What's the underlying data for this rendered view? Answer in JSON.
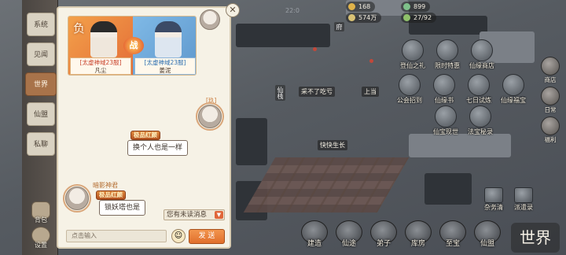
{
  "resources": [
    {
      "icon": "copper-coin-icon",
      "value": "168",
      "color": "#e0b34a"
    },
    {
      "icon": "jade-icon",
      "value": "899",
      "color": "#7ec08a"
    },
    {
      "icon": "spirit-stone-icon",
      "value": "574万",
      "color": "#d9c275"
    },
    {
      "icon": "population-icon",
      "value": "27/92",
      "color": "#8fc06a"
    }
  ],
  "map_timer": "22:0",
  "map_labels": {
    "hut": "府",
    "shop_sign": "仙栈",
    "leek": "采不了吃亏",
    "sign": "上当",
    "crop": "快快生长"
  },
  "map_buttons": [
    {
      "label": "登仙之礼",
      "icon": "gift-icon"
    },
    {
      "label": "限时特惠",
      "icon": "sale-icon"
    },
    {
      "label": "仙缘商店",
      "icon": "store-icon"
    },
    {
      "label": "公会招到",
      "icon": "guild-icon"
    },
    {
      "label": "仙缘书",
      "icon": "book-icon"
    },
    {
      "label": "七日试炼",
      "icon": "trial-icon"
    },
    {
      "label": "仙缘福宝",
      "icon": "treasure-icon"
    },
    {
      "label": "仙宝现世",
      "icon": "artifact-icon"
    },
    {
      "label": "法宝秘录",
      "icon": "scroll-icon"
    }
  ],
  "side_buttons": [
    {
      "label": "商店",
      "icon": "shop-icon"
    },
    {
      "label": "日常",
      "icon": "daily-icon"
    },
    {
      "label": "福利",
      "icon": "welfare-icon"
    }
  ],
  "small_boards": [
    {
      "label": "杂务清",
      "icon": "chores-icon"
    },
    {
      "label": "派遣录",
      "icon": "dispatch-icon"
    }
  ],
  "bottom_nav": [
    {
      "label": "建造",
      "icon": "build-icon"
    },
    {
      "label": "仙途",
      "icon": "path-icon"
    },
    {
      "label": "弟子",
      "icon": "disciple-icon"
    },
    {
      "label": "库房",
      "icon": "storehouse-icon"
    },
    {
      "label": "至宝",
      "icon": "treasure-chest-icon"
    },
    {
      "label": "仙盟",
      "icon": "alliance-icon"
    }
  ],
  "world_button": "世界",
  "tabs": [
    {
      "label": "系统",
      "active": false
    },
    {
      "label": "见闻",
      "active": false
    },
    {
      "label": "世界",
      "active": true
    },
    {
      "label": "仙盟",
      "active": false
    },
    {
      "label": "私聊",
      "active": false
    }
  ],
  "bag_label": "背包",
  "settings_label": "设置",
  "battle": {
    "result": "负",
    "vs": "战",
    "left": {
      "server": "[太虚神域23服]",
      "name": "凡尘"
    },
    "right": {
      "server": "[太虚神域23服]",
      "name": "姜泥"
    }
  },
  "messages": [
    {
      "side": "right",
      "level": "[玖]",
      "title": "极品红颜",
      "text": "换个人也是一样"
    },
    {
      "side": "left",
      "name": "暗影神君",
      "title": "极品红颜",
      "text": "锁妖塔也是"
    }
  ],
  "unread": "您有未读消息",
  "input_placeholder": "点击输入",
  "emoji_icon": "☺",
  "send_label": "发 送",
  "close_symbol": "✕"
}
